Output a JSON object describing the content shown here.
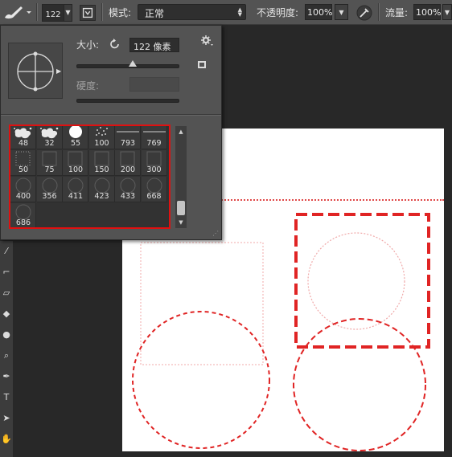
{
  "options_bar": {
    "brush_size": "122",
    "mode_label": "模式:",
    "mode_value": "正常",
    "opacity_label": "不透明度:",
    "opacity_value": "100%",
    "flow_label": "流量:",
    "flow_value": "100%",
    "caret": "▼"
  },
  "brush_picker": {
    "size_label": "大小:",
    "size_value": "122 像素",
    "hardness_label": "硬度:",
    "size_slider_fraction": 0.55,
    "presets": [
      {
        "size": "48",
        "kind": "splat"
      },
      {
        "size": "32",
        "kind": "splat"
      },
      {
        "size": "55",
        "kind": "hard-round"
      },
      {
        "size": "100",
        "kind": "spatter"
      },
      {
        "size": "793",
        "kind": "line"
      },
      {
        "size": "769",
        "kind": "line"
      },
      {
        "size": "50",
        "kind": "dotted-square"
      },
      {
        "size": "75",
        "kind": "square"
      },
      {
        "size": "100",
        "kind": "square"
      },
      {
        "size": "150",
        "kind": "square"
      },
      {
        "size": "200",
        "kind": "square"
      },
      {
        "size": "300",
        "kind": "square"
      },
      {
        "size": "400",
        "kind": "circle"
      },
      {
        "size": "356",
        "kind": "circle"
      },
      {
        "size": "411",
        "kind": "circle"
      },
      {
        "size": "423",
        "kind": "circle"
      },
      {
        "size": "433",
        "kind": "circle"
      },
      {
        "size": "668",
        "kind": "circle"
      },
      {
        "size": "686",
        "kind": "circle"
      }
    ],
    "scrollbar_position_fraction": 0.85
  },
  "colors": {
    "highlight_red": "#e01010",
    "dashed_stroke": "#e02424",
    "faint_stroke": "#f0a8a8",
    "canvas": "#ffffff",
    "panel": "#535353"
  },
  "tool_icons": [
    "brush-icon",
    "crop-icon",
    "eraser-icon",
    "paint-bucket-icon",
    "drop-icon",
    "zoom-icon",
    "pen-icon",
    "text-icon",
    "path-select-icon",
    "hand-icon"
  ]
}
